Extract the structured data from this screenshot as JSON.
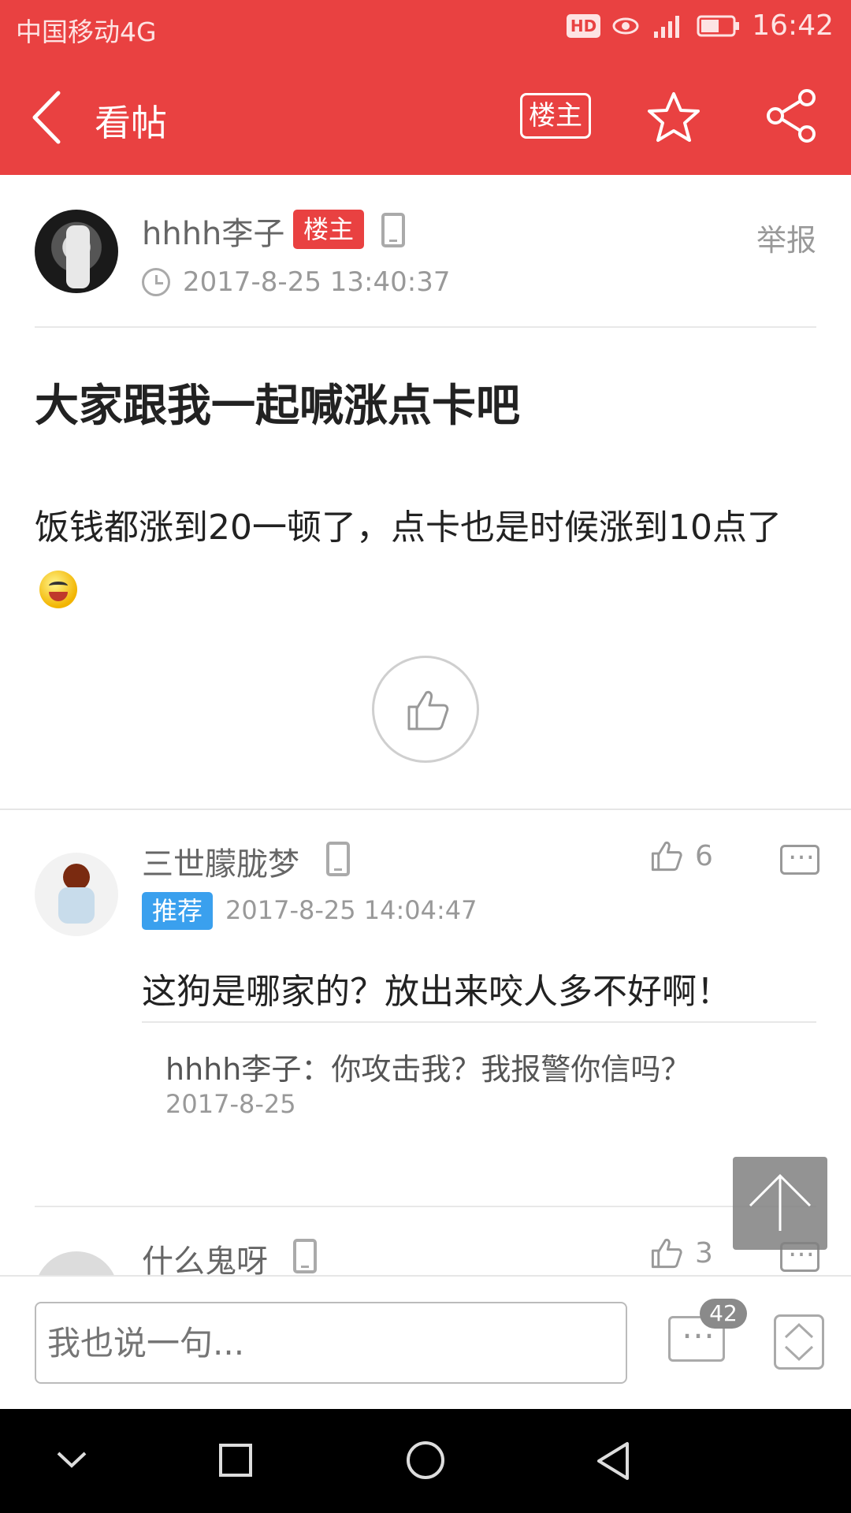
{
  "status_bar": {
    "carrier": "中国移动4G",
    "hd_badge": "HD",
    "time": "16:42"
  },
  "app_bar": {
    "back_icon": "chevron-left-icon",
    "title": "看帖",
    "op_only_label": "楼主",
    "favorite_icon": "star-icon",
    "share_icon": "share-icon"
  },
  "post": {
    "author": "hhhh李子",
    "author_badge": "楼主",
    "device_icon": "phone-icon",
    "time": "2017-8-25 13:40:37",
    "report_label": "举报",
    "title": "大家跟我一起喊涨点卡吧",
    "body": "饭钱都涨到20一顿了，点卡也是时候涨到10点了"
  },
  "comments": [
    {
      "author": "三世朦胧梦",
      "badge": "推荐",
      "time": "2017-8-25 14:04:47",
      "likes": "6",
      "text": "这狗是哪家的？放出来咬人多不好啊！",
      "reply": {
        "text": "hhhh李子：你攻击我？我报警你信吗？",
        "time": "2017-8-25"
      }
    },
    {
      "author": "什么鬼呀",
      "likes": "3"
    }
  ],
  "bottom_bar": {
    "input_placeholder": "我也说一句...",
    "comment_count": "42"
  },
  "colors": {
    "brand_red": "#e94141",
    "recommend_blue": "#3aa0ee"
  }
}
